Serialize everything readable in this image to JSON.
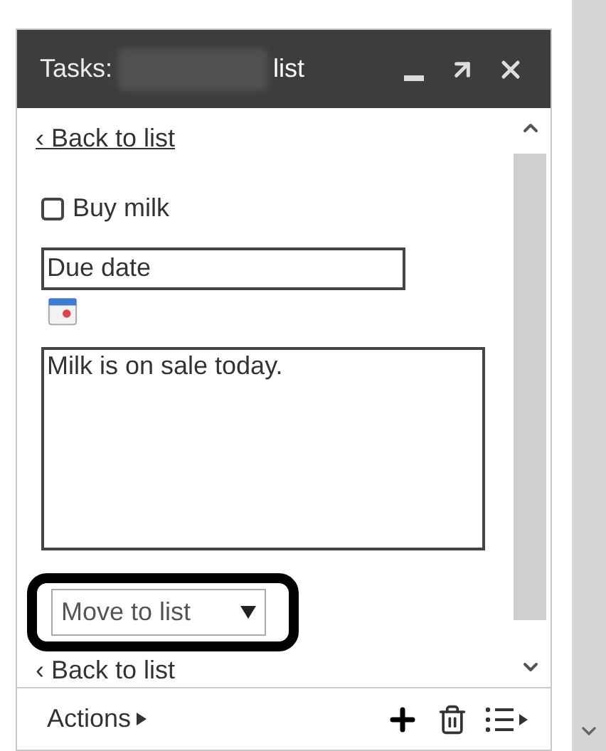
{
  "title": {
    "prefix": "Tasks:",
    "suffix": "list"
  },
  "back_link_top": "‹ Back to list",
  "task": {
    "title": "Buy milk",
    "checked": false
  },
  "due_date": {
    "placeholder": "Due date"
  },
  "notes": "Milk is on sale today.",
  "move_to_list": {
    "label": "Move to list",
    "highlighted": true
  },
  "back_link_bottom": "‹ Back to list",
  "footer": {
    "actions": "Actions"
  }
}
